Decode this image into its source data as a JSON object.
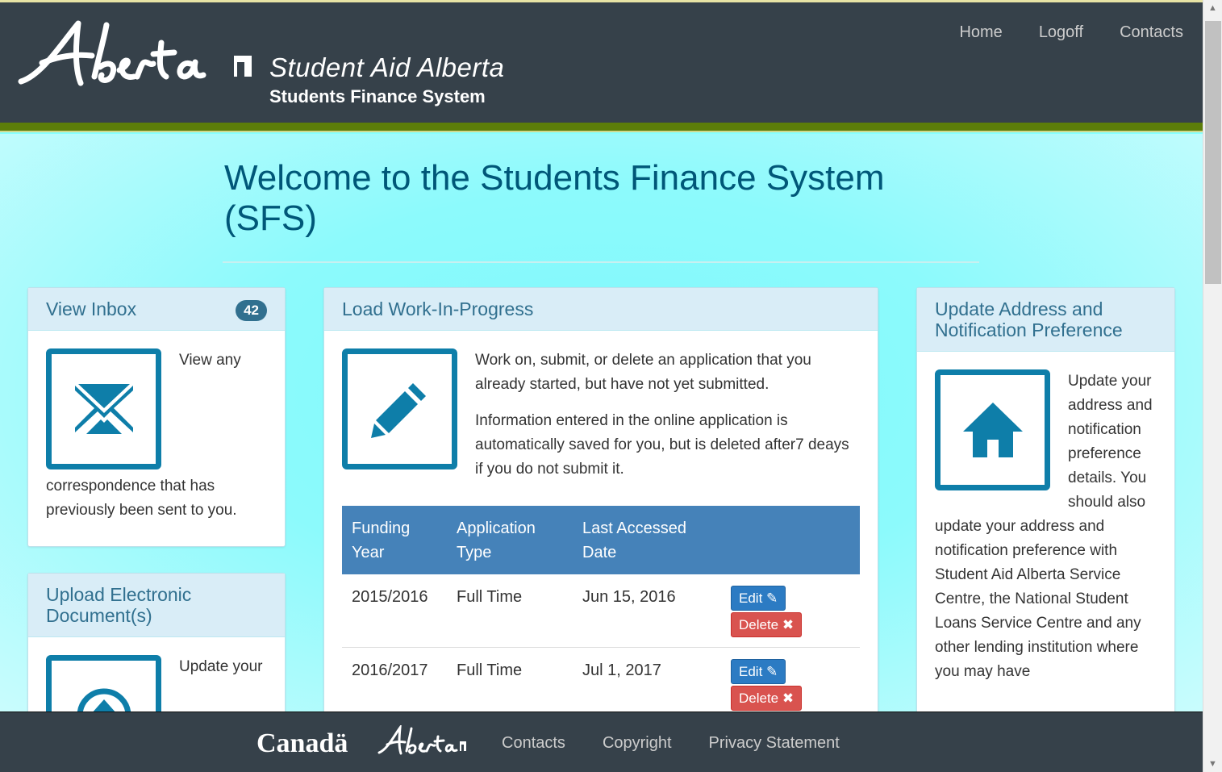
{
  "header": {
    "site_name": "Student Aid Alberta",
    "site_subtitle": "Students Finance System",
    "nav": [
      "Home",
      "Logoff",
      "Contacts"
    ]
  },
  "welcome": "Welcome to the Students Finance System (SFS)",
  "inbox": {
    "title": "View Inbox",
    "badge": "42",
    "body": "View any correspondence that has previously been sent to you."
  },
  "upload": {
    "title": "Upload Electronic Document(s)",
    "body": "Update your"
  },
  "wip": {
    "title": "Load Work-In-Progress",
    "p1": "Work on, submit, or delete an application that you already started, but have not yet submitted.",
    "p2": "Information entered in the online application is automatically saved for you, but is deleted after7 deays if you do not submit it.",
    "columns": [
      "Funding Year",
      "Application Type",
      "Last Accessed Date"
    ],
    "rows": [
      {
        "year": "2015/2016",
        "type": "Full Time",
        "date": "Jun 15, 2016"
      },
      {
        "year": "2016/2017",
        "type": "Full Time",
        "date": "Jul 1, 2017"
      }
    ],
    "edit_label": "Edit",
    "delete_label": "Delete"
  },
  "address": {
    "title": "Update Address and Notification Preference",
    "body": "Update your address and notification preference details. You should also update your address and notification preference with Student Aid Alberta Service Centre, the National Student Loans Service Centre and any other lending institution where you may have"
  },
  "footer": {
    "canada": "Canadä",
    "links": [
      "Contacts",
      "Copyright",
      "Privacy Statement"
    ]
  },
  "colors": {
    "header_bg": "#36414a",
    "accent_green": "#5c7d09",
    "panel_head": "#d9edf7",
    "table_head": "#4582b9",
    "edit": "#2c7bc3",
    "delete": "#d9534f"
  }
}
